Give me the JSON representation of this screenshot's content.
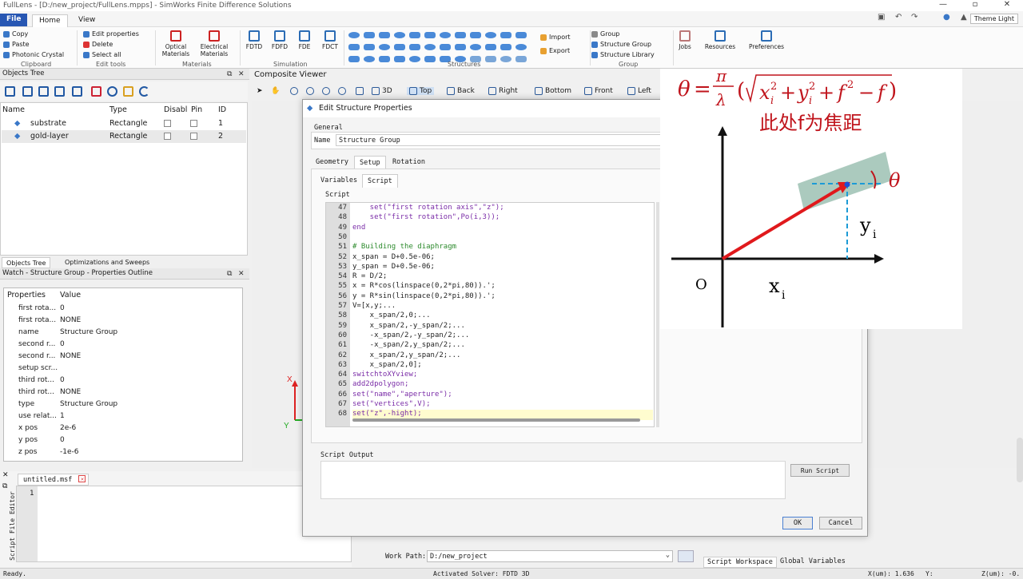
{
  "window": {
    "title": "FullLens - [D:/new_project/FullLens.mpps] - SimWorks Finite Difference Solutions"
  },
  "menu": {
    "file": "File",
    "home": "Home",
    "view": "View"
  },
  "theme": "Theme Light",
  "ribbon": {
    "clipboard": {
      "copy": "Copy",
      "paste": "Paste",
      "photonic": "Photonic Crystal",
      "label": "Clipboard"
    },
    "edit": {
      "edit_props": "Edit properties",
      "delete": "Delete",
      "select_all": "Select all",
      "label": "Edit tools"
    },
    "materials": {
      "optical": "Optical Materials",
      "electrical": "Electrical Materials",
      "label": "Materials"
    },
    "simulation": {
      "fdtd": "FDTD",
      "fdfd": "FDFD",
      "fde": "FDE",
      "fdct": "FDCT",
      "label": "Simulation"
    },
    "structures": {
      "label": "Structures",
      "import": "Import",
      "export": "Export"
    },
    "group": {
      "group": "Group",
      "structure_group": "Structure Group",
      "structure_library": "Structure Library",
      "label": "Group"
    },
    "jobs": "Jobs",
    "resources": "Resources",
    "preferences": "Preferences"
  },
  "objects_tree": {
    "title": "Objects Tree",
    "headers": {
      "name": "Name",
      "type": "Type",
      "disable": "Disabl",
      "pin": "Pin",
      "id": "ID"
    },
    "rows": [
      {
        "name": "substrate",
        "type": "Rectangle",
        "id": "1"
      },
      {
        "name": "gold-layer",
        "type": "Rectangle",
        "id": "2"
      }
    ],
    "tab1": "Objects Tree",
    "tab2": "Optimizations and Sweeps"
  },
  "watch": {
    "title": "Watch - Structure Group - Properties Outline",
    "headers": {
      "prop": "Properties",
      "val": "Value"
    },
    "rows": [
      {
        "k": "first rota...",
        "v": "0"
      },
      {
        "k": "first rota...",
        "v": "NONE"
      },
      {
        "k": "name",
        "v": "Structure Group"
      },
      {
        "k": "second r...",
        "v": "0"
      },
      {
        "k": "second r...",
        "v": "NONE"
      },
      {
        "k": "setup scr...",
        "v": ""
      },
      {
        "k": "third rot...",
        "v": "0"
      },
      {
        "k": "third rot...",
        "v": "NONE"
      },
      {
        "k": "type",
        "v": "Structure Group"
      },
      {
        "k": "use relat...",
        "v": "1"
      },
      {
        "k": "x pos",
        "v": "2e-6"
      },
      {
        "k": "y pos",
        "v": "0"
      },
      {
        "k": "z pos",
        "v": "-1e-6"
      }
    ]
  },
  "editor": {
    "tab": "untitled.msf",
    "line": "1",
    "side": "Script File Editor"
  },
  "viewer": {
    "title": "Composite Viewer",
    "views": {
      "v3d": "3D",
      "top": "Top",
      "back": "Back",
      "right": "Right",
      "bottom": "Bottom",
      "front": "Front",
      "left": "Left"
    },
    "axes": {
      "x": "X",
      "y": "Y"
    }
  },
  "dialog": {
    "title": "Edit Structure Properties",
    "general": "General",
    "name_label": "Name",
    "name_value": "Structure Group",
    "tabs": {
      "geometry": "Geometry",
      "setup": "Setup",
      "rotation": "Rotation"
    },
    "subtabs": {
      "variables": "Variables",
      "script": "Script"
    },
    "script_label": "Script",
    "output_label": "Script Output",
    "run": "Run Script",
    "ok": "OK",
    "cancel": "Cancel",
    "code": [
      {
        "n": "47",
        "t": "    set(\"first rotation axis\",\"z\");"
      },
      {
        "n": "48",
        "t": "    set(\"first rotation\",Po(i,3));"
      },
      {
        "n": "49",
        "t": "end"
      },
      {
        "n": "50",
        "t": ""
      },
      {
        "n": "51",
        "t": "# Building the diaphragm"
      },
      {
        "n": "52",
        "t": "x_span = D+0.5e-06;"
      },
      {
        "n": "53",
        "t": "y_span = D+0.5e-06;"
      },
      {
        "n": "54",
        "t": "R = D/2;"
      },
      {
        "n": "55",
        "t": "x = R*cos(linspace(0,2*pi,80)).';"
      },
      {
        "n": "56",
        "t": "y = R*sin(linspace(0,2*pi,80)).';"
      },
      {
        "n": "57",
        "t": "V=[x,y;..."
      },
      {
        "n": "58",
        "t": "    x_span/2,0;..."
      },
      {
        "n": "59",
        "t": "    x_span/2,-y_span/2;..."
      },
      {
        "n": "60",
        "t": "    -x_span/2,-y_span/2;..."
      },
      {
        "n": "61",
        "t": "    -x_span/2,y_span/2;..."
      },
      {
        "n": "62",
        "t": "    x_span/2,y_span/2;..."
      },
      {
        "n": "63",
        "t": "    x_span/2,0];"
      },
      {
        "n": "64",
        "t": "switchtoXYview;"
      },
      {
        "n": "65",
        "t": "add2dpolygon;"
      },
      {
        "n": "66",
        "t": "set(\"name\",\"aperture\");"
      },
      {
        "n": "67",
        "t": "set(\"vertices\",V);"
      },
      {
        "n": "68",
        "t": "set(\"z\",-hight);"
      }
    ]
  },
  "overlay": {
    "note": "此处f为焦距",
    "o": "O",
    "xi": "x",
    "yi": "y",
    "sub": "i",
    "theta": "θ"
  },
  "workpath": {
    "label": "Work Path:",
    "value": "D:/new_project"
  },
  "workspace": {
    "tab1": "Script Workspace",
    "tab2": "Global Variables"
  },
  "status": {
    "left": "Ready.",
    "solver": "Activated Solver: FDTD 3D",
    "x": "X(um):  1.636",
    "y": "Y:",
    "z": "Z(um):  -0."
  }
}
